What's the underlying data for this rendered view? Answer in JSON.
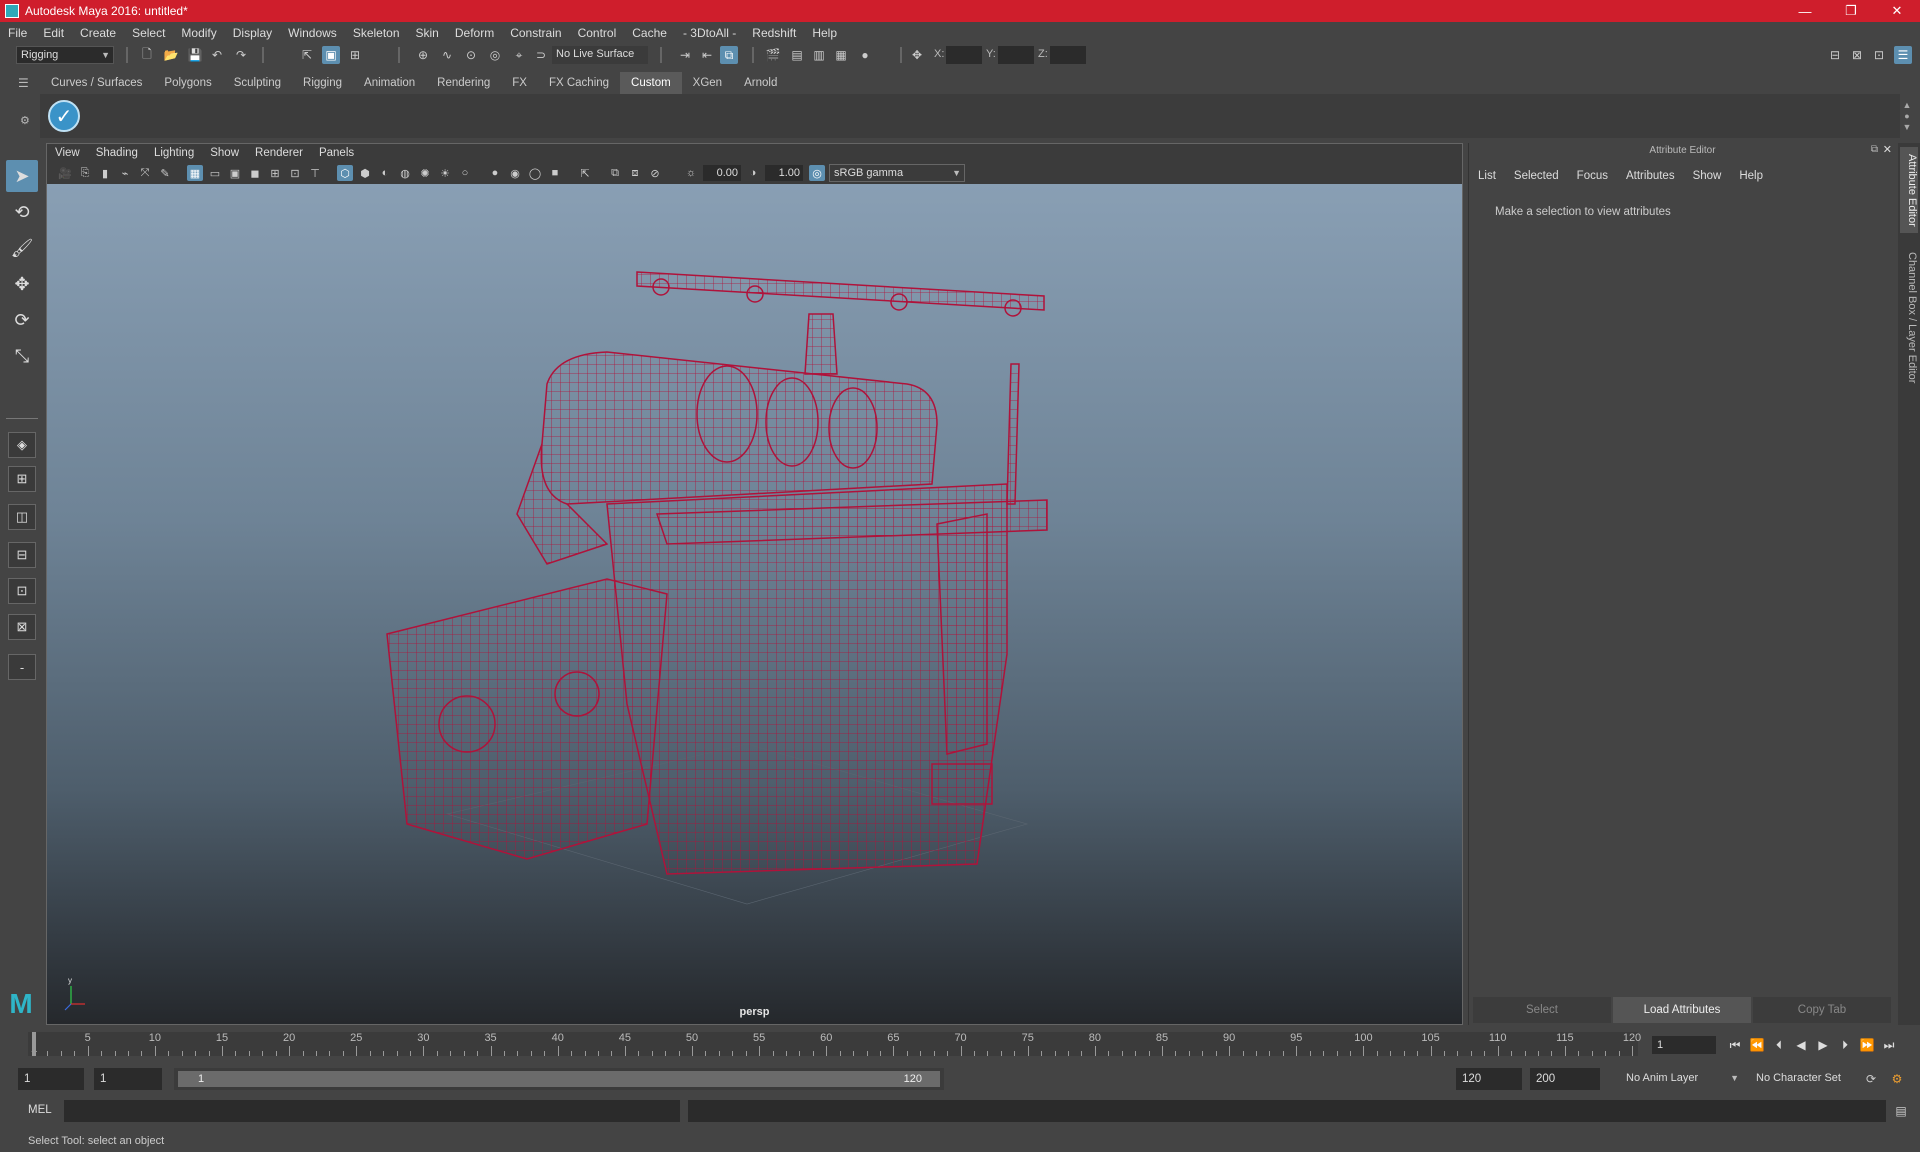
{
  "window": {
    "title": "Autodesk Maya 2016: untitled*",
    "minimize_glyph": "—",
    "maximize_glyph": "❐",
    "close_glyph": "✕"
  },
  "menubar": [
    "File",
    "Edit",
    "Create",
    "Select",
    "Modify",
    "Display",
    "Windows",
    "Skeleton",
    "Skin",
    "Deform",
    "Constrain",
    "Control",
    "Cache",
    "- 3DtoAll -",
    "Redshift",
    "Help"
  ],
  "toolbar": {
    "menuset": "Rigging",
    "live_surface": "No Live Surface",
    "x_label": "X:",
    "y_label": "Y:",
    "z_label": "Z:"
  },
  "shelf": {
    "tabs": [
      "Curves / Surfaces",
      "Polygons",
      "Sculpting",
      "Rigging",
      "Animation",
      "Rendering",
      "FX",
      "FX Caching",
      "Custom",
      "XGen",
      "Arnold"
    ],
    "active_tab": "Custom",
    "button_glyph": "✓"
  },
  "viewport": {
    "menu": [
      "View",
      "Shading",
      "Lighting",
      "Show",
      "Renderer",
      "Panels"
    ],
    "exposure": "0.00",
    "gamma": "1.00",
    "color_space": "sRGB gamma",
    "camera": "persp",
    "axis_y": "y",
    "wire_color": "#b0123a"
  },
  "attribute_editor": {
    "title": "Attribute Editor",
    "menu": [
      "List",
      "Selected",
      "Focus",
      "Attributes",
      "Show",
      "Help"
    ],
    "message": "Make a selection to view attributes",
    "buttons": [
      "Select",
      "Load Attributes",
      "Copy Tab"
    ],
    "side_tabs": [
      "Attribute Editor",
      "Channel Box / Layer Editor"
    ]
  },
  "timeline": {
    "start": 1,
    "end": 120,
    "labels": [
      "1",
      "5",
      "10",
      "15",
      "20",
      "25",
      "30",
      "35",
      "40",
      "45",
      "50",
      "55",
      "60",
      "65",
      "70",
      "75",
      "80",
      "85",
      "90",
      "95",
      "100",
      "105",
      "110",
      "115",
      "120"
    ],
    "current_frame": "1"
  },
  "range": {
    "start_time": "1",
    "playback_start": "1",
    "slider_start": "1",
    "slider_end": "120",
    "playback_end": "120",
    "end_time": "200",
    "anim_layer": "No Anim Layer",
    "character_set": "No Character Set"
  },
  "command_line": {
    "language": "MEL"
  },
  "status": {
    "help_line": "Select Tool: select an object"
  },
  "colors": {
    "title_bar": "#cf1e2c",
    "accent": "#5d8fb0"
  }
}
